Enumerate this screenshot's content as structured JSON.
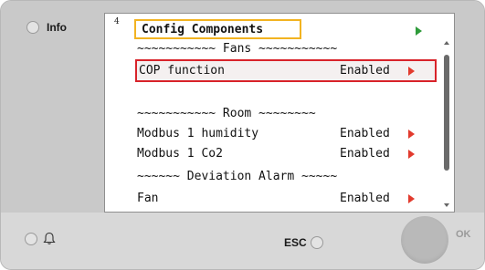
{
  "panel": {
    "info_label": "Info",
    "esc_label": "ESC",
    "ok_label": "OK"
  },
  "screen": {
    "page_number": "4",
    "title": "Config Components",
    "rows": [
      {
        "label": "~~~~~~~~~~~ Fans ~~~~~~~~~~~",
        "value": "",
        "arrow": false,
        "selected": false
      },
      {
        "label": "COP function",
        "value": "Enabled",
        "arrow": true,
        "selected": true
      },
      {
        "label": "",
        "value": "",
        "arrow": false,
        "selected": false
      },
      {
        "label": "~~~~~~~~~~~ Room ~~~~~~~~",
        "value": "",
        "arrow": false,
        "selected": false
      },
      {
        "label": "Modbus 1 humidity",
        "value": "Enabled",
        "arrow": true,
        "selected": false
      },
      {
        "label": "Modbus 1 Co2",
        "value": "Enabled",
        "arrow": true,
        "selected": false
      },
      {
        "label": "~~~~~~ Deviation Alarm ~~~~~",
        "value": "",
        "arrow": false,
        "selected": false
      },
      {
        "label": "Fan",
        "value": "Enabled",
        "arrow": true,
        "selected": false
      }
    ]
  },
  "icons": {
    "info_led": "led-indicator",
    "alarm": "bell-icon",
    "title_arrow": "green-right-arrow",
    "row_arrow": "red-right-arrow"
  },
  "colors": {
    "title_highlight": "#f2b321",
    "selection": "#d8232a",
    "row_arrow": "#e23b2e",
    "title_arrow": "#2e9b3a"
  }
}
